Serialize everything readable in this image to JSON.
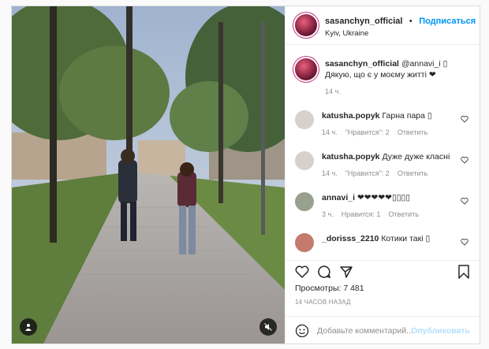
{
  "header": {
    "username": "sasanchyn_official",
    "separator": "•",
    "follow_label": "Подписаться",
    "location": "Kyiv, Ukraine"
  },
  "caption": {
    "username": "sasanchyn_official",
    "text": "@annavi_i ▯ Дякую, що є у моєму житті ❤",
    "time": "14 ч."
  },
  "comments": [
    {
      "username": "katusha.popyk",
      "text": "Гарна пара ▯",
      "time": "14 ч.",
      "likes": "\"Нравится\": 2",
      "reply": "Ответить"
    },
    {
      "username": "katusha.popyk",
      "text": "Дуже дуже класні",
      "time": "14 ч.",
      "likes": "\"Нравится\": 2",
      "reply": "Ответить"
    },
    {
      "username": "annavi_i",
      "text": "❤❤❤❤❤▯▯▯▯",
      "time": "3 ч.",
      "likes": "Нравится: 1",
      "reply": "Ответить"
    },
    {
      "username": "_dorisss_2210",
      "text": "Котики такі ▯",
      "time": "",
      "likes": "",
      "reply": ""
    }
  ],
  "stats": {
    "views": "Просмотры: 7 481",
    "posted_ago": "14 ЧАСОВ НАЗАД"
  },
  "add_comment": {
    "placeholder": "Добавьте комментарий...",
    "publish_label": "Опубликовать"
  },
  "icons": [
    "user-tag-icon",
    "mute-icon",
    "heart-icon",
    "comment-icon",
    "share-icon",
    "bookmark-icon",
    "emoji-icon"
  ],
  "colors": {
    "accent": "#0095f6",
    "publish_disabled": "#b2dffc",
    "muted_text": "#8e8e8e"
  }
}
